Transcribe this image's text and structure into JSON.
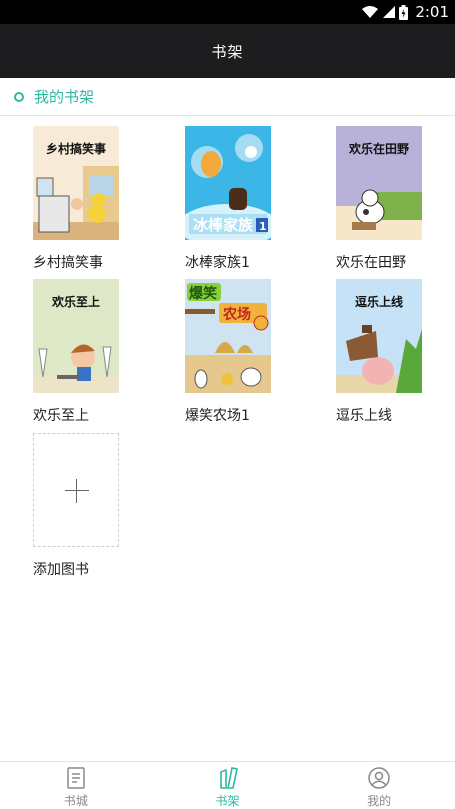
{
  "status_bar": {
    "time": "2:01"
  },
  "app_bar": {
    "title": "书架"
  },
  "section": {
    "label": "我的书架"
  },
  "books": [
    {
      "title": "乡村搞笑事",
      "cover_text": "乡村搞笑事"
    },
    {
      "title": "冰棒家族1",
      "cover_text": "冰棒家族1"
    },
    {
      "title": "欢乐在田野",
      "cover_text": "欢乐在田野"
    },
    {
      "title": "欢乐至上",
      "cover_text": "欢乐至上"
    },
    {
      "title": "爆笑农场1",
      "cover_text": "爆笑农场"
    },
    {
      "title": "逗乐上线",
      "cover_text": "逗乐上线"
    }
  ],
  "add_book": {
    "label": "添加图书"
  },
  "tabs": [
    {
      "label": "书城",
      "icon": "book-icon"
    },
    {
      "label": "书架",
      "icon": "bookshelf-icon",
      "active": true
    },
    {
      "label": "我的",
      "icon": "profile-icon"
    }
  ],
  "colors": {
    "accent": "#2fb9a0",
    "app_bar": "#1d1d20",
    "status_bar": "#000000"
  }
}
